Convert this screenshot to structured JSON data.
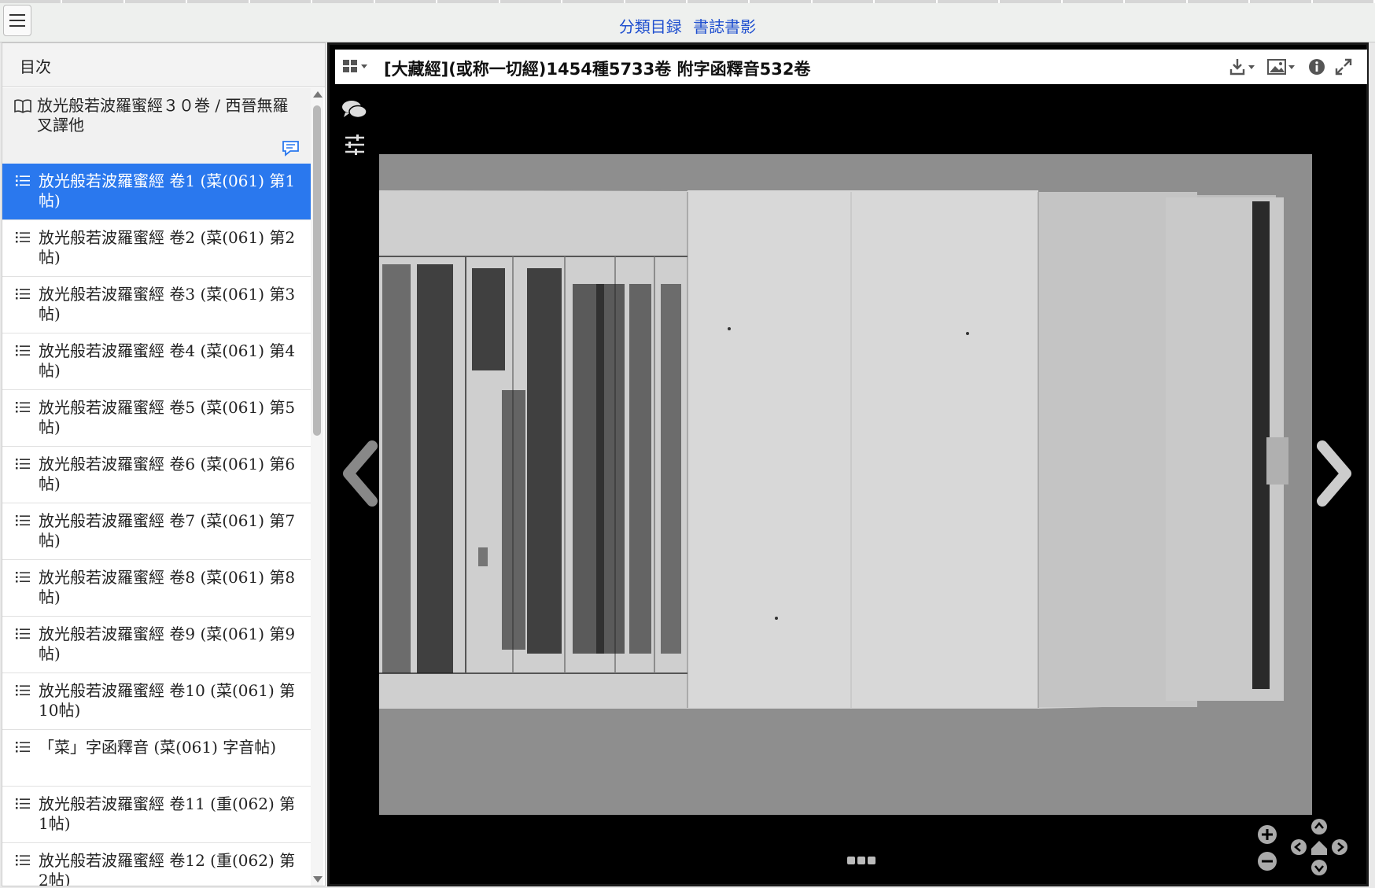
{
  "topbar": {
    "links": [
      "分類目録",
      "書誌書影"
    ]
  },
  "sidebar": {
    "title": "目次",
    "root": "放光般若波羅蜜經３０巻 / 西晉無羅叉譯他",
    "items": [
      {
        "label": "放光般若波羅蜜經 卷1 (菜(061) 第1帖)",
        "active": true
      },
      {
        "label": "放光般若波羅蜜經 卷2 (菜(061) 第2帖)"
      },
      {
        "label": "放光般若波羅蜜經 卷3 (菜(061) 第3帖)"
      },
      {
        "label": "放光般若波羅蜜經 卷4 (菜(061) 第4帖)"
      },
      {
        "label": "放光般若波羅蜜經 卷5 (菜(061) 第5帖)"
      },
      {
        "label": "放光般若波羅蜜經 卷6 (菜(061) 第6帖)"
      },
      {
        "label": "放光般若波羅蜜經 卷7 (菜(061) 第7帖)"
      },
      {
        "label": "放光般若波羅蜜經 卷8 (菜(061) 第8帖)"
      },
      {
        "label": "放光般若波羅蜜經 卷9 (菜(061) 第9帖)"
      },
      {
        "label": "放光般若波羅蜜經 卷10 (菜(061) 第10帖)"
      },
      {
        "label": "「菜」字函釋音 (菜(061) 字音帖)"
      },
      {
        "label": "放光般若波羅蜜經 卷11 (重(062) 第1帖)"
      },
      {
        "label": "放光般若波羅蜜經 卷12 (重(062) 第2帖)"
      }
    ]
  },
  "viewer": {
    "title": "[大藏經](或称一切經)1454種5733卷 附字函釋音532卷",
    "icons": [
      "view-grid-icon",
      "download-icon",
      "image-icon",
      "info-icon",
      "fullscreen-icon",
      "comment-icon",
      "adjust-icon",
      "zoom-in-icon",
      "zoom-out-icon",
      "pan-icon",
      "home-icon"
    ]
  },
  "colors": {
    "accent": "#2a78ee",
    "link": "#1f4fcf",
    "viewer_bg": "#000000"
  }
}
